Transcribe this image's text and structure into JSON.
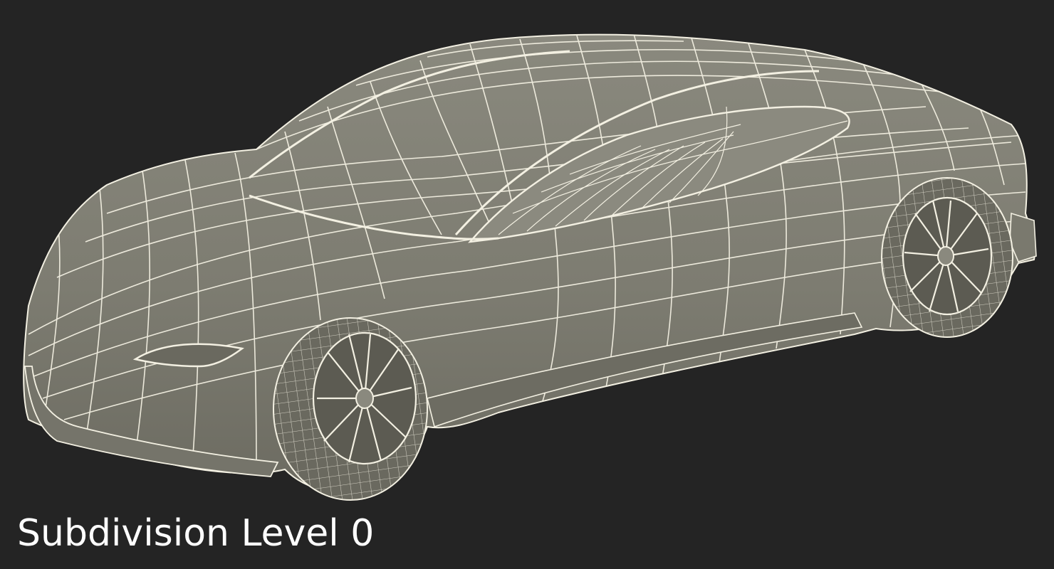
{
  "viewport": {
    "background_color": "#242424",
    "model_fill_color": "#7f7e73",
    "wire_color": "#f3f0e2"
  },
  "model": {
    "subject": "sports car wireframe render",
    "view": "front three-quarter"
  },
  "caption": {
    "text": "Subdivision Level 0"
  }
}
